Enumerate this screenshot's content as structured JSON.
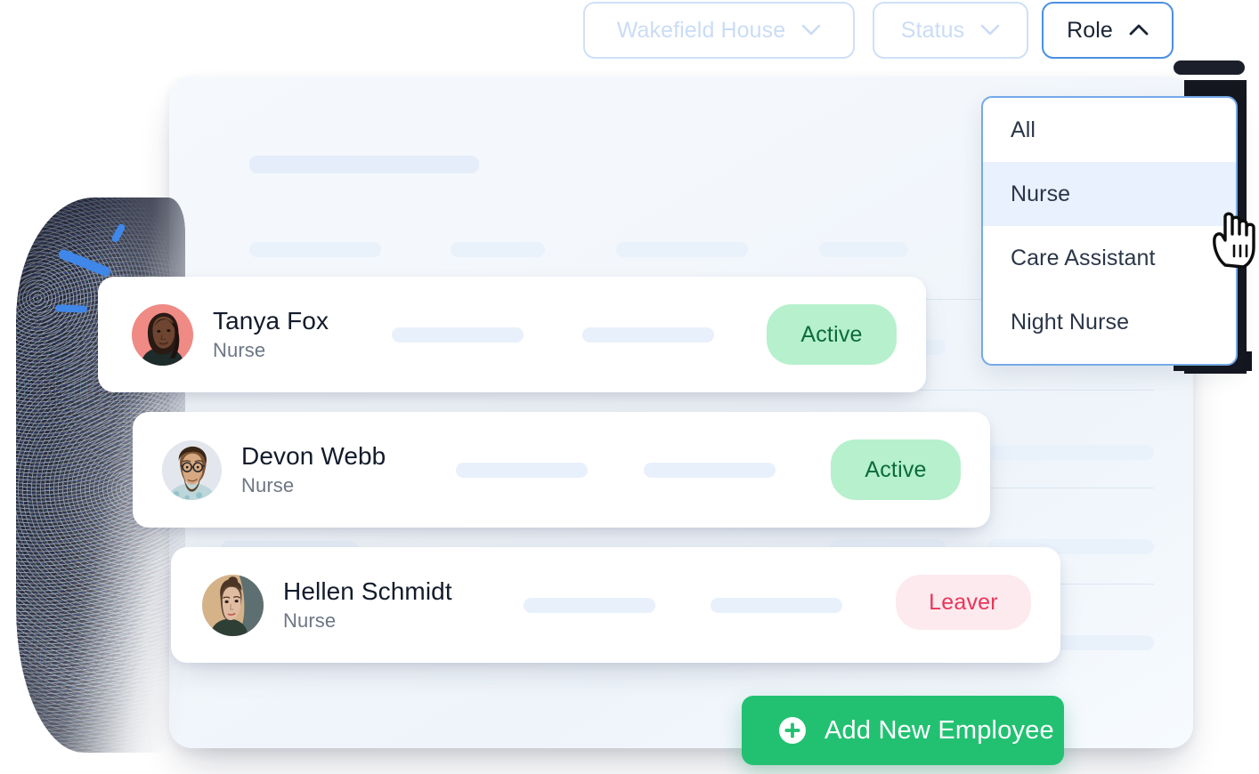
{
  "filters": {
    "location": {
      "label": "Wakefield House",
      "icon": "chevron-down-icon",
      "state": "inactive"
    },
    "status": {
      "label": "Status",
      "icon": "chevron-down-icon",
      "state": "inactive"
    },
    "role": {
      "label": "Role",
      "icon": "chevron-up-icon",
      "state": "open"
    }
  },
  "role_dropdown": {
    "selected": "Nurse",
    "options": [
      {
        "label": "All",
        "highlighted": false
      },
      {
        "label": "Nurse",
        "highlighted": true
      },
      {
        "label": "Care Assistant",
        "highlighted": false
      },
      {
        "label": "Night Nurse",
        "highlighted": false
      }
    ]
  },
  "employees": [
    {
      "name": "Tanya Fox",
      "role": "Nurse",
      "status": "Active",
      "status_type": "active",
      "avatar": "avatar-tanya-fox"
    },
    {
      "name": "Devon Webb",
      "role": "Nurse",
      "status": "Active",
      "status_type": "active",
      "avatar": "avatar-devon-webb"
    },
    {
      "name": "Hellen Schmidt",
      "role": "Nurse",
      "status": "Leaver",
      "status_type": "leaver",
      "avatar": "avatar-hellen-schmidt"
    }
  ],
  "actions": {
    "add_employee": {
      "label": "Add New Employee",
      "icon": "plus-circle-icon"
    }
  },
  "cursor": {
    "icon": "pointing-hand-cursor"
  },
  "colors": {
    "accent_green": "#22c172",
    "badge_active_bg": "#b6f0cd",
    "badge_active_text": "#0c6b3d",
    "badge_leaver_bg": "#fdeaee",
    "badge_leaver_text": "#e8365a",
    "filter_active_border": "#4a90e2",
    "filter_inactive_border": "#cfe0f7",
    "dropdown_highlight": "#e8f1fd",
    "panel_bg": "#f3f7fc"
  }
}
